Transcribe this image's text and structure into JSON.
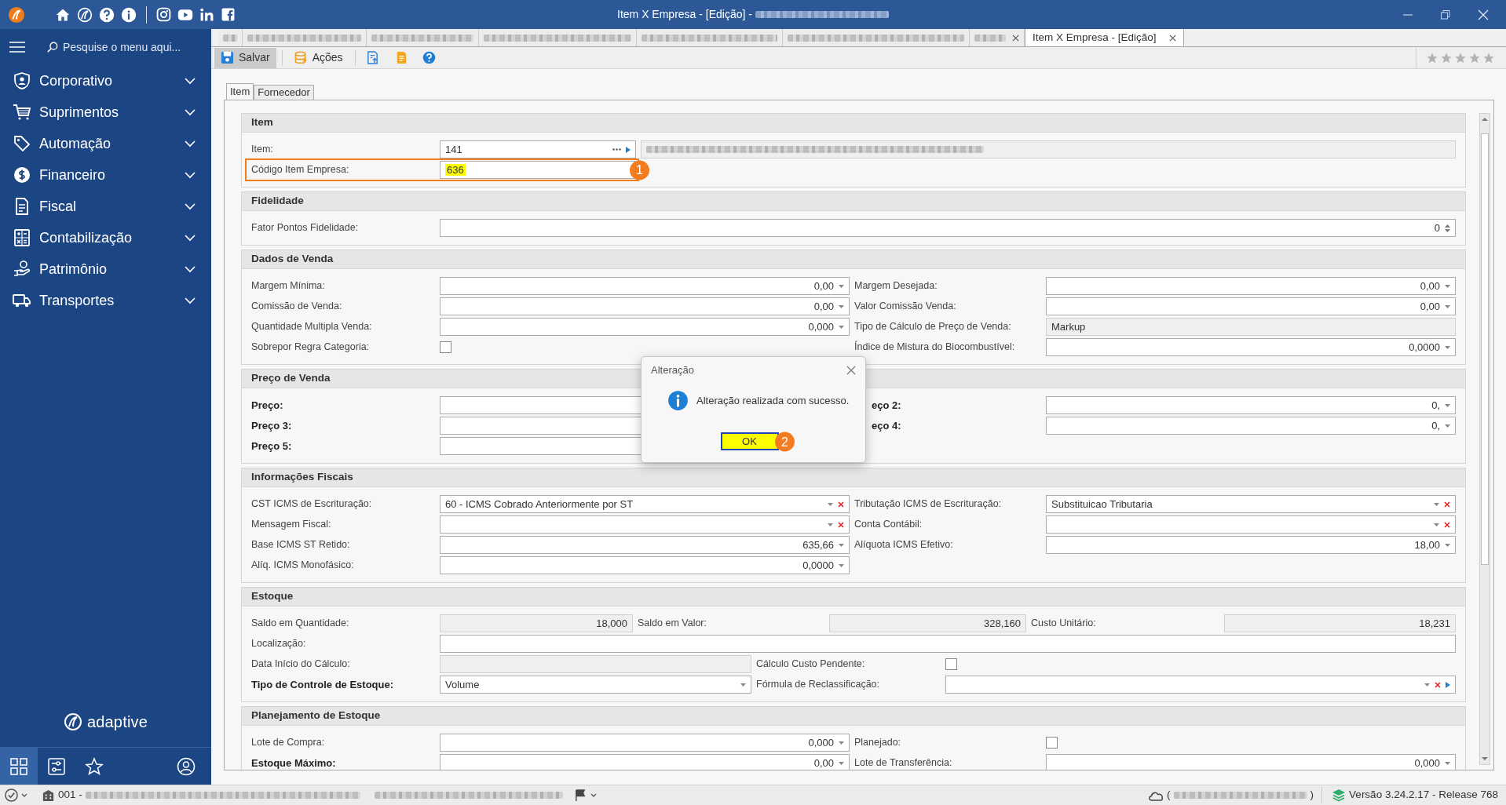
{
  "window": {
    "title": "Item X Empresa - [Edição] -"
  },
  "sidebar": {
    "search": {
      "placeholder": "Pesquise o menu aqui..."
    },
    "items": [
      {
        "label": "Corporativo",
        "expanded": false
      },
      {
        "label": "Suprimentos",
        "expanded": false
      },
      {
        "label": "Automação",
        "expanded": false
      },
      {
        "label": "Financeiro",
        "expanded": false
      },
      {
        "label": "Fiscal",
        "expanded": false
      },
      {
        "label": "Contabilização",
        "expanded": false
      },
      {
        "label": "Patrimônio",
        "expanded": false
      },
      {
        "label": "Transportes",
        "expanded": false
      }
    ],
    "brand": "adaptive",
    "bottom_icons": [
      {
        "selected": true
      },
      {
        "selected": false
      },
      {
        "selected": false
      },
      {
        "selected": false
      }
    ]
  },
  "document_tabs": [
    {
      "selected": false
    },
    {
      "selected": false
    },
    {
      "selected": false
    },
    {
      "selected": false
    },
    {
      "selected": false
    },
    {
      "selected": false
    },
    {
      "selected": false
    },
    {
      "label": "Item X Empresa - [Edição]",
      "selected": true
    }
  ],
  "toolbar": {
    "buttons": [
      {
        "label": "Salvar",
        "kind": "save",
        "pressed": true
      },
      {
        "label": "Ações",
        "kind": "actions",
        "pressed": false
      }
    ],
    "rating": {
      "stars": 0
    }
  },
  "inner_tabs": [
    {
      "label": "Item",
      "selected": true
    },
    {
      "label": "Fornecedor",
      "selected": false
    }
  ],
  "sections": [
    {
      "title": "Item",
      "kind": "item",
      "rows": [
        {
          "cells": [
            {
              "label": "Item:",
              "field": {
                "kind": "lookup",
                "value": "141"
              }
            },
            {
              "field": {
                "kind": "readonly",
                "blurred": true
              }
            }
          ]
        },
        {
          "cells": [
            {
              "label": "Código Item Empresa:",
              "highlighted": true,
              "badge": "1",
              "field": {
                "kind": "text",
                "value": "636"
              }
            }
          ]
        }
      ]
    },
    {
      "title": "Fidelidade",
      "kind": "two_column",
      "rows": [
        {
          "cells": [
            {
              "label": "Fator Pontos Fidelidade:",
              "full_width": true,
              "field": {
                "kind": "spin",
                "value": "0"
              }
            }
          ]
        }
      ]
    },
    {
      "title": "Dados de Venda",
      "kind": "two_column",
      "rows": [
        {
          "cells": [
            {
              "label": "Margem Mínima:",
              "field": {
                "kind": "number",
                "value": "0,00"
              }
            },
            {
              "label": "Margem Desejada:",
              "field": {
                "kind": "number",
                "value": "0,00"
              }
            }
          ]
        },
        {
          "cells": [
            {
              "label": "Comissão de Venda:",
              "field": {
                "kind": "number",
                "value": "0,00"
              }
            },
            {
              "label": "Valor Comissão Venda:",
              "field": {
                "kind": "number",
                "value": "0,00"
              }
            }
          ]
        },
        {
          "cells": [
            {
              "label": "Quantidade Multipla Venda:",
              "field": {
                "kind": "number",
                "value": "0,000"
              }
            },
            {
              "label": "Tipo de Cálculo de Preço de Venda:",
              "field": {
                "kind": "readonly",
                "value": "Markup"
              }
            }
          ]
        },
        {
          "cells": [
            {
              "label": "Sobrepor Regra Categoria:",
              "field": {
                "kind": "checkbox",
                "checked": false
              }
            },
            {
              "label": "Índice de Mistura do Biocombustível:",
              "field": {
                "kind": "number",
                "value": "0,0000"
              }
            }
          ]
        }
      ]
    },
    {
      "title": "Preço de Venda",
      "kind": "two_column",
      "rows": [
        {
          "cells": [
            {
              "label": "Preço:",
              "bold": true,
              "field": {
                "kind": "number",
                "covered": true
              }
            },
            {
              "label": "eço 2:",
              "bold": true,
              "covered": true,
              "field": {
                "kind": "number",
                "value": "0,"
              }
            }
          ]
        },
        {
          "cells": [
            {
              "label": "Preço 3:",
              "bold": true,
              "field": {
                "kind": "number",
                "covered": true
              }
            },
            {
              "label": "eço 4:",
              "bold": true,
              "covered": true,
              "field": {
                "kind": "number",
                "value": "0,"
              }
            }
          ]
        },
        {
          "cells": [
            {
              "label": "Preço 5:",
              "bold": true,
              "field": {
                "kind": "number",
                "covered": true
              }
            }
          ]
        }
      ]
    },
    {
      "title": "Informações Fiscais",
      "kind": "two_column",
      "rows": [
        {
          "cells": [
            {
              "label": "CST ICMS de Escrituração:",
              "field": {
                "kind": "combo",
                "value": "60 - ICMS Cobrado Anteriormente por ST"
              }
            },
            {
              "label": "Tributação ICMS de Escrituração:",
              "field": {
                "kind": "combo",
                "value": "Substituicao Tributaria"
              }
            }
          ]
        },
        {
          "cells": [
            {
              "label": "Mensagem Fiscal:",
              "field": {
                "kind": "combo"
              }
            },
            {
              "label": "Conta Contábil:",
              "field": {
                "kind": "combo"
              }
            }
          ]
        },
        {
          "cells": [
            {
              "label": "Base ICMS ST Retido:",
              "field": {
                "kind": "number",
                "value": "635,66"
              }
            },
            {
              "label": "Alíquota ICMS Efetivo:",
              "field": {
                "kind": "number",
                "value": "18,00"
              }
            }
          ]
        },
        {
          "cells": [
            {
              "label": "Alíq. ICMS Monofásico:",
              "field": {
                "kind": "number",
                "value": "0,0000"
              }
            }
          ]
        }
      ]
    },
    {
      "title": "Estoque",
      "kind": "three_column",
      "rows": [
        {
          "cells": [
            {
              "label": "Saldo em Quantidade:",
              "field": {
                "kind": "readonly_number",
                "value": "18,000"
              }
            },
            {
              "label": "Saldo em Valor:",
              "field": {
                "kind": "readonly_number",
                "value": "328,160"
              }
            },
            {
              "label": "Custo Unitário:",
              "field": {
                "kind": "readonly_number",
                "value": "18,231"
              }
            }
          ]
        },
        {
          "cells": [
            {
              "label": "Localização:",
              "full_width": true,
              "field": {
                "kind": "text"
              }
            }
          ]
        },
        {
          "cells": [
            {
              "label": "Data Início do Cálculo:",
              "field": {
                "kind": "readonly"
              }
            },
            {
              "label": "Cálculo Custo Pendente:",
              "field": {
                "kind": "checkbox",
                "checked": false
              }
            }
          ]
        },
        {
          "cells": [
            {
              "label": "Tipo de Controle de Estoque:",
              "bold": true,
              "field": {
                "kind": "select",
                "value": "Volume"
              }
            },
            {
              "label": "Fórmula de Reclassificação:",
              "field": {
                "kind": "lookup_combo"
              }
            }
          ]
        }
      ]
    },
    {
      "title": "Planejamento de Estoque",
      "kind": "two_column",
      "rows": [
        {
          "cells": [
            {
              "label": "Lote de Compra:",
              "field": {
                "kind": "number",
                "value": "0,000"
              }
            },
            {
              "label": "Planejado:",
              "field": {
                "kind": "checkbox",
                "checked": false
              }
            }
          ]
        },
        {
          "cells": [
            {
              "label": "Estoque Máximo:",
              "bold": true,
              "field": {
                "kind": "number",
                "value": "0,00"
              }
            },
            {
              "label": "Lote de Transferência:",
              "field": {
                "kind": "number",
                "value": "0,000"
              }
            }
          ]
        }
      ]
    }
  ],
  "dialog": {
    "title": "Alteração",
    "message": "Alteração realizada com sucesso.",
    "ok": {
      "label": "OK",
      "highlighted": true,
      "badge": "2"
    }
  },
  "status_bar": {
    "company": "001 -",
    "server": {
      "open": "(",
      "close": ")"
    },
    "version": "Versão 3.24.2.17 - Release 768"
  }
}
